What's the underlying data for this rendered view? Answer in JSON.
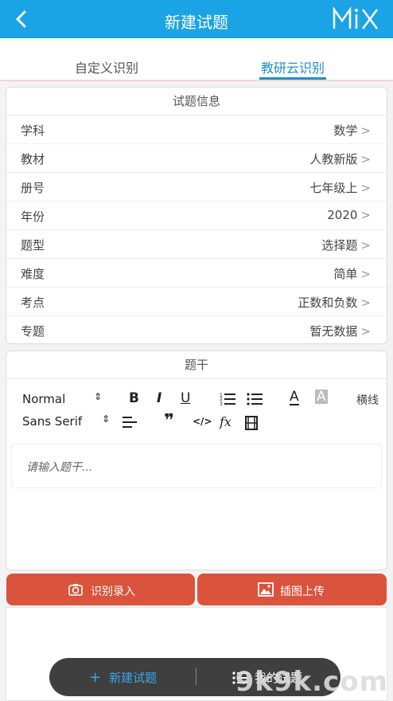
{
  "header": {
    "title": "新建试题",
    "logo": "MiX"
  },
  "tabs": [
    {
      "label": "自定义识别",
      "active": false
    },
    {
      "label": "教研云识别",
      "active": true
    }
  ],
  "info": {
    "title": "试题信息",
    "rows": [
      {
        "label": "学科",
        "value": "数学"
      },
      {
        "label": "教材",
        "value": "人教新版"
      },
      {
        "label": "册号",
        "value": "七年级上"
      },
      {
        "label": "年份",
        "value": "2020"
      },
      {
        "label": "题型",
        "value": "选择题"
      },
      {
        "label": "难度",
        "value": "简单"
      },
      {
        "label": "考点",
        "value": "正数和负数"
      },
      {
        "label": "专题",
        "value": "暂无数据"
      }
    ],
    "chevron": ">"
  },
  "stem": {
    "title": "题干",
    "toolbar": {
      "heading_select": "Normal",
      "font_select": "Sans Serif",
      "bold": "B",
      "italic": "I",
      "underline": "U",
      "font_color": "A",
      "highlight": "A",
      "hr": "横线",
      "code": "</>",
      "formula": "fx"
    },
    "placeholder": "请输入题干..."
  },
  "actions": {
    "recognize": "识别录入",
    "upload": "插图上传"
  },
  "bottom_bar": {
    "new": "新建试题",
    "mine": "我的试题"
  },
  "watermark": "9k9k.com",
  "colors": {
    "primary": "#1aa3e5",
    "accent_button": "#d9533d",
    "tab_active": "#1a8fd0"
  }
}
